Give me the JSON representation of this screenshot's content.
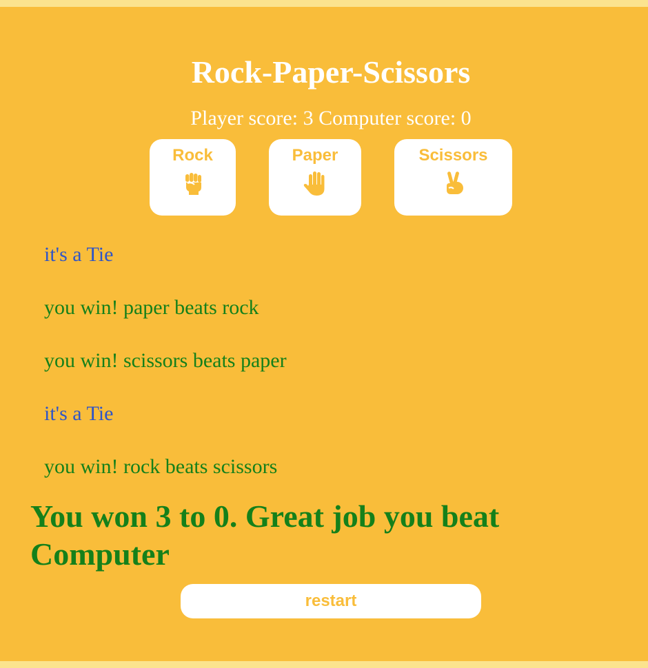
{
  "game": {
    "title": "Rock-Paper-Scissors",
    "score_text": "Player score: 3 Computer score: 0"
  },
  "choices": [
    {
      "label": "Rock",
      "icon": "fist-icon"
    },
    {
      "label": "Paper",
      "icon": "raised-hand-icon"
    },
    {
      "label": "Scissors",
      "icon": "victory-hand-icon"
    }
  ],
  "results": [
    {
      "text": "it's a Tie",
      "outcome": "tie"
    },
    {
      "text": "you win! paper beats rock",
      "outcome": "win"
    },
    {
      "text": "you win! scissors beats paper",
      "outcome": "win"
    },
    {
      "text": "it's a Tie",
      "outcome": "tie"
    },
    {
      "text": "you win! rock beats scissors",
      "outcome": "win"
    }
  ],
  "final_message": "You won 3 to 0. Great job you beat Computer",
  "restart_label": "restart",
  "colors": {
    "background": "#f9bd3a",
    "outer_border": "#fbe38e",
    "tie": "#2f55c7",
    "win": "#15801a",
    "button_text": "#f9bd3a",
    "button_background": "#ffffff"
  }
}
